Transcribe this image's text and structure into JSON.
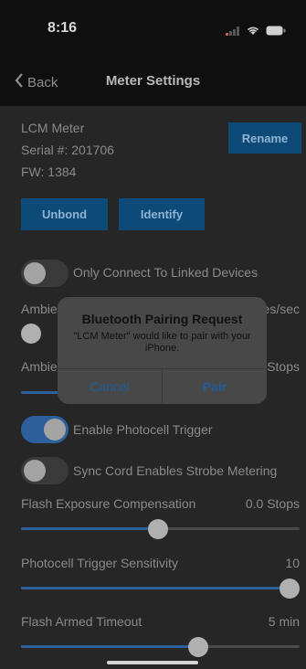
{
  "status": {
    "time": "8:16"
  },
  "nav": {
    "back_label": "Back",
    "title": "Meter Settings"
  },
  "meter": {
    "name": "LCM Meter",
    "serial": "Serial #: 201706",
    "fw": "FW: 1384",
    "rename_label": "Rename",
    "unbond_label": "Unbond",
    "identify_label": "Identify"
  },
  "settings": {
    "only_connect_label": "Only Connect To Linked Devices",
    "ambient1_label": "Ambie",
    "ambient1_value": "es/sec",
    "ambient2_label": "Ambie",
    "ambient2_value": "Stops",
    "photocell_label": "Enable Photocell Trigger",
    "sync_label": "Sync Cord Enables Strobe Metering",
    "flash_comp_label": "Flash Exposure Compensation",
    "flash_comp_value": "0.0 Stops",
    "flash_comp_level": 0.51,
    "sensitivity_label": "Photocell Trigger Sensitivity",
    "sensitivity_value": "10",
    "sensitivity_level": 1.0,
    "timeout_label": "Flash Armed Timeout",
    "timeout_value": "5 min",
    "timeout_level": 0.66,
    "only_connect_on": false,
    "photocell_on": true,
    "sync_on": false
  },
  "dialog": {
    "title": "Bluetooth Pairing Request",
    "message": "\"LCM Meter\" would like to pair with your iPhone.",
    "cancel_label": "Cancel",
    "pair_label": "Pair"
  },
  "colors": {
    "accent": "#2d5f9a",
    "button": "#0e4a78",
    "dialog_link": "#1f5c99"
  }
}
